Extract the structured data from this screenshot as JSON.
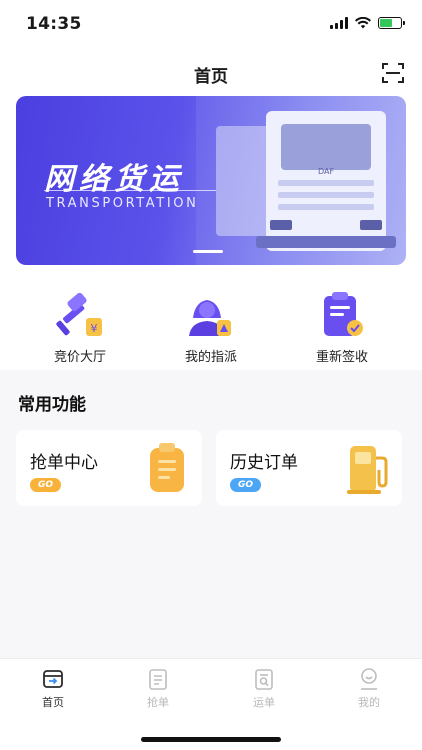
{
  "status": {
    "time": "14:35"
  },
  "nav": {
    "title": "首页",
    "scan_icon": "scan-icon"
  },
  "banner": {
    "title": "网络货运",
    "subtitle": "TRANSPORTATION",
    "truck_badge": "DAF",
    "gradient_start": "#4b3fe0",
    "gradient_end": "#b9bef6"
  },
  "quick_actions": [
    {
      "label": "竞价大厅",
      "icon": "auction-hammer-icon"
    },
    {
      "label": "我的指派",
      "icon": "assigned-user-icon"
    },
    {
      "label": "重新签收",
      "icon": "re-sign-clipboard-icon"
    }
  ],
  "section": {
    "title": "常用功能"
  },
  "features": [
    {
      "label": "抢单中心",
      "badge": "GO",
      "icon": "clipboard-icon",
      "badge_color": "#f8b23a"
    },
    {
      "label": "历史订单",
      "badge": "GO",
      "icon": "fuel-pump-icon",
      "badge_color": "#4da6f5"
    }
  ],
  "tabs": [
    {
      "label": "首页",
      "icon": "home-tab-icon",
      "active": true
    },
    {
      "label": "抢单",
      "icon": "grab-order-tab-icon",
      "active": false
    },
    {
      "label": "运单",
      "icon": "waybill-tab-icon",
      "active": false
    },
    {
      "label": "我的",
      "icon": "profile-tab-icon",
      "active": false
    }
  ],
  "colors": {
    "accent": "#4b3fe0",
    "orange": "#f8b23a",
    "blue": "#4da6f5"
  }
}
